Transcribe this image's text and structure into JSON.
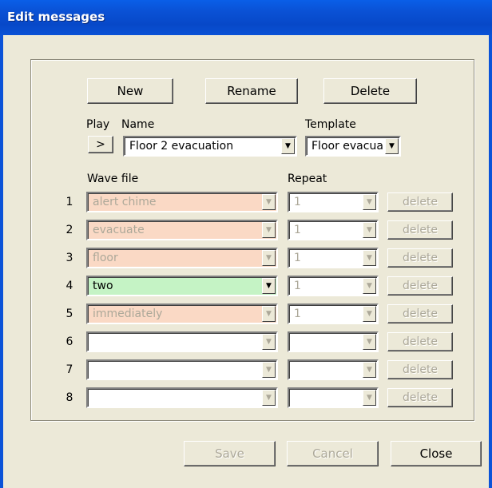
{
  "window": {
    "title": "Edit messages"
  },
  "toolbar": {
    "new_label": "New",
    "rename_label": "Rename",
    "delete_label": "Delete"
  },
  "labels": {
    "play": "Play",
    "name": "Name",
    "template": "Template",
    "wave_file": "Wave file",
    "repeat": "Repeat"
  },
  "play_button": ">",
  "name_value": "Floor 2 evacuation",
  "template_value": "Floor evacuat",
  "rows": [
    {
      "num": "1",
      "wave": "alert chime",
      "repeat": "1",
      "delete": "delete",
      "state": "peach"
    },
    {
      "num": "2",
      "wave": "evacuate",
      "repeat": "1",
      "delete": "delete",
      "state": "peach"
    },
    {
      "num": "3",
      "wave": "floor",
      "repeat": "1",
      "delete": "delete",
      "state": "peach"
    },
    {
      "num": "4",
      "wave": "two",
      "repeat": "1",
      "delete": "delete",
      "state": "green"
    },
    {
      "num": "5",
      "wave": "immediately",
      "repeat": "1",
      "delete": "delete",
      "state": "peach"
    },
    {
      "num": "6",
      "wave": "",
      "repeat": "",
      "delete": "delete",
      "state": "empty"
    },
    {
      "num": "7",
      "wave": "",
      "repeat": "",
      "delete": "delete",
      "state": "empty"
    },
    {
      "num": "8",
      "wave": "",
      "repeat": "",
      "delete": "delete",
      "state": "empty"
    }
  ],
  "footer": {
    "save_label": "Save",
    "cancel_label": "Cancel",
    "close_label": "Close"
  },
  "colors": {
    "title_blue": "#0a52d6",
    "dialog_bg": "#ece9d8",
    "peach": "#fad9c5",
    "green": "#c5f3c5"
  }
}
